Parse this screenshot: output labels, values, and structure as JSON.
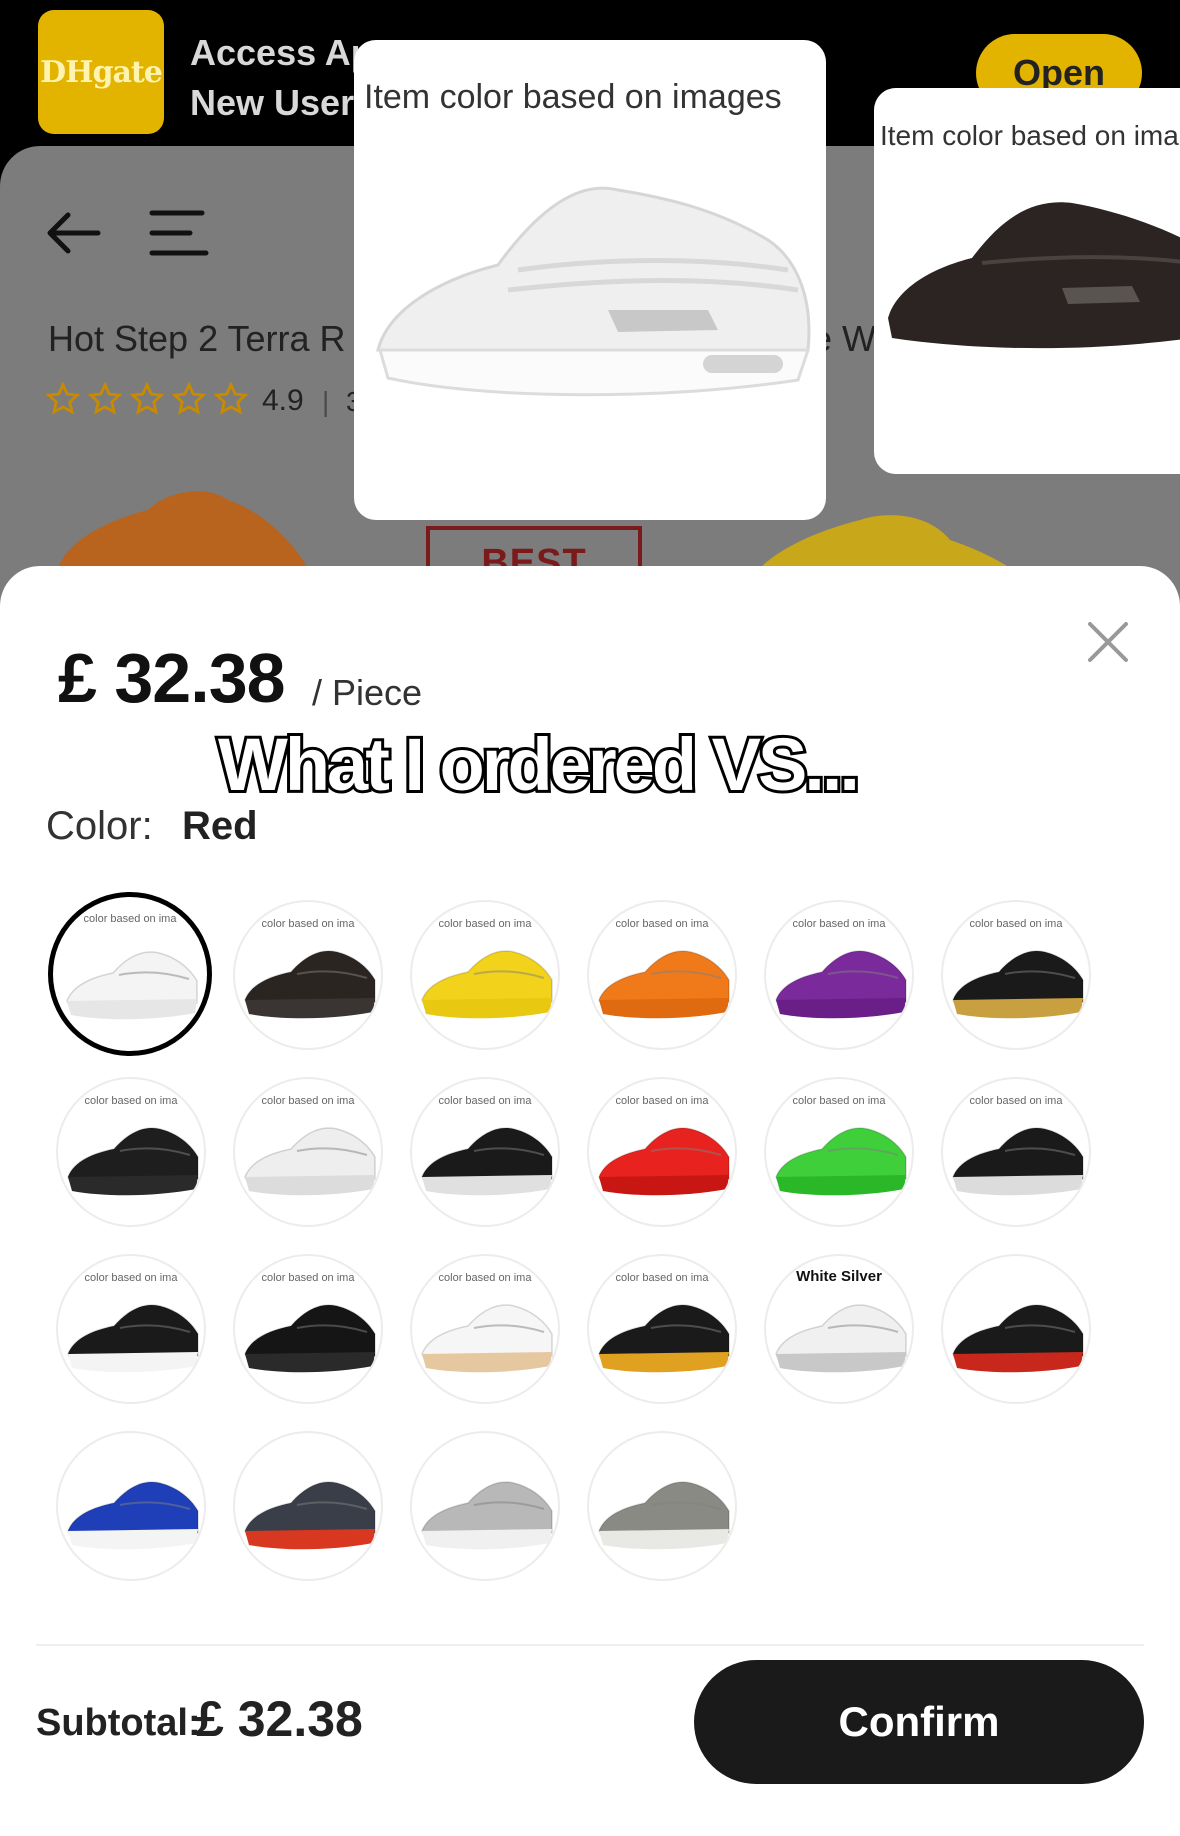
{
  "banner": {
    "logo": "DHgate",
    "line1": "Access Ap",
    "line2": "New User",
    "open_label": "Open"
  },
  "product": {
    "title": "Hot Step 2 Terra R",
    "title_tail": "e W",
    "rating": "4.9",
    "rating_sep": "|",
    "rating_cut": "3",
    "stars": 5,
    "badge": "BEST QUALITY"
  },
  "cards": [
    {
      "caption": "Item color based on images",
      "shoe_color": "#f2f2f2"
    },
    {
      "caption": "Item color based on ima",
      "shoe_color": "#2a2422"
    }
  ],
  "sheet": {
    "price": "£ 32.38",
    "unit": "/ Piece",
    "overlay": "What I ordered VS...",
    "color_label": "Color:",
    "color_value": "Red",
    "subtotal_label": "Subtotal:",
    "subtotal_value": "£ 32.38",
    "confirm_label": "Confirm"
  },
  "swatches": [
    {
      "tag": "color based on ima",
      "upper": "#f4f4f4",
      "sole": "#e6e6e6",
      "selected": true
    },
    {
      "tag": "color based on ima",
      "upper": "#2b2522",
      "sole": "#3a3432"
    },
    {
      "tag": "color based on ima",
      "upper": "#f2d21b",
      "sole": "#e8c810"
    },
    {
      "tag": "color based on ima",
      "upper": "#f07a1a",
      "sole": "#e06a10"
    },
    {
      "tag": "color based on ima",
      "upper": "#7a2a9a",
      "sole": "#6a1f88"
    },
    {
      "tag": "color based on ima",
      "upper": "#1a1a1a",
      "sole": "#c9a040"
    },
    {
      "tag": "color based on ima",
      "upper": "#1e1e1e",
      "sole": "#2a2a2a"
    },
    {
      "tag": "color based on ima",
      "upper": "#eeeeee",
      "sole": "#dcdcdc"
    },
    {
      "tag": "color based on ima",
      "upper": "#1a1a1a",
      "sole": "#e0e0e0"
    },
    {
      "tag": "color based on ima",
      "upper": "#e8231f",
      "sole": "#c81612"
    },
    {
      "tag": "color based on ima",
      "upper": "#3ecf3a",
      "sole": "#2bb828"
    },
    {
      "tag": "color based on ima",
      "upper": "#1a1a1a",
      "sole": "#dcdcdc"
    },
    {
      "tag": "color based on ima",
      "upper": "#1a1a1a",
      "sole": "#f4f4f4"
    },
    {
      "tag": "color based on ima",
      "upper": "#151515",
      "sole": "#2a2a2a"
    },
    {
      "tag": "color based on ima",
      "upper": "#f6f6f6",
      "sole": "#e6c8a0"
    },
    {
      "tag": "color based on ima",
      "upper": "#1a1a1a",
      "sole": "#e0a020"
    },
    {
      "tag": "White Silver",
      "upper": "#f0f0f0",
      "sole": "#c8c8c8",
      "bold": true
    },
    {
      "tag": "",
      "upper": "#1a1a1a",
      "sole": "#c8281c"
    },
    {
      "tag": "",
      "upper": "#1f3fb8",
      "sole": "#f4f4f4"
    },
    {
      "tag": "",
      "upper": "#3a3e48",
      "sole": "#d8381f"
    },
    {
      "tag": "",
      "upper": "#b8b8b8",
      "sole": "#f0f0f0"
    },
    {
      "tag": "",
      "upper": "#8a8a84",
      "sole": "#e8e8e4"
    }
  ]
}
